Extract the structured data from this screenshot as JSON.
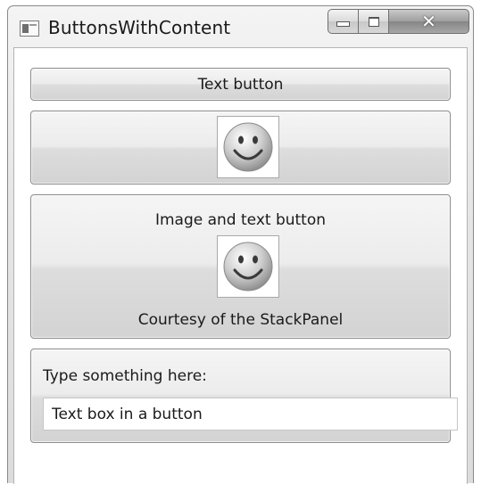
{
  "window": {
    "title": "ButtonsWithContent",
    "icons": {
      "app": "window-app-icon",
      "minimize": "minimize-icon",
      "maximize": "maximize-icon",
      "close": "close-icon",
      "close_glyph": "✕"
    }
  },
  "buttons": {
    "text_button": {
      "label": "Text button"
    },
    "image_button": {
      "image": "smiley-face-icon"
    },
    "image_text_button": {
      "label_top": "Image and text button",
      "image": "smiley-face-icon",
      "label_bottom": "Courtesy of the StackPanel"
    },
    "textbox_button": {
      "prompt": "Type something here:",
      "textbox_value": "Text box in a button"
    }
  }
}
